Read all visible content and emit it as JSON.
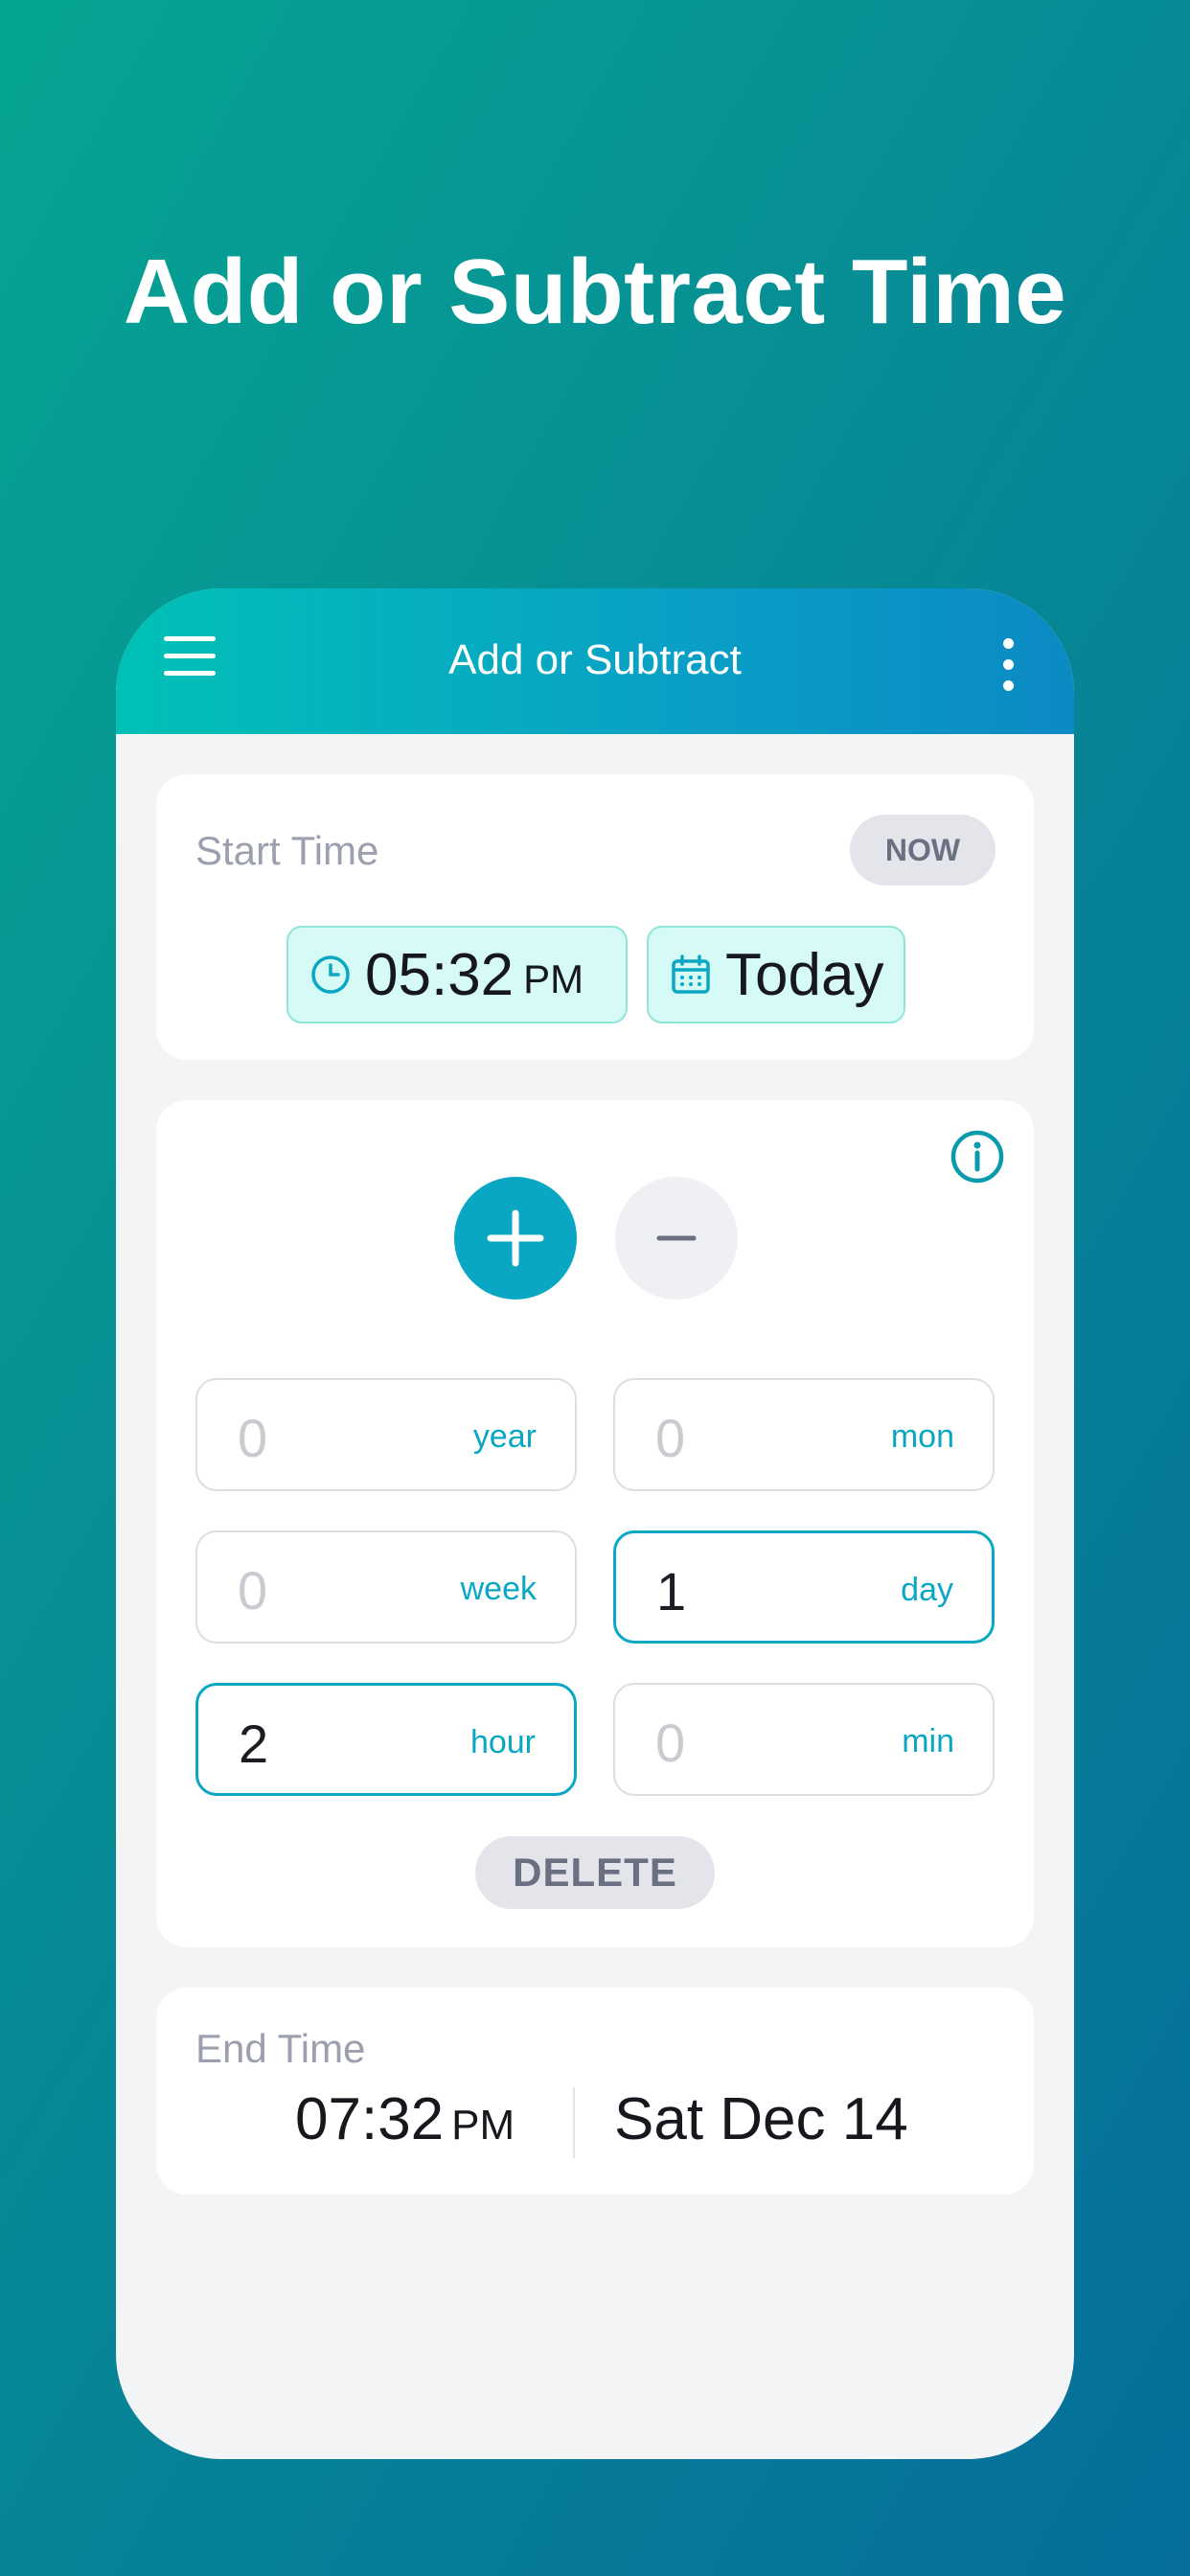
{
  "headline": "Add or Subtract Time",
  "appbar": {
    "title": "Add or Subtract",
    "menu_icon": "hamburger-menu-icon",
    "more_icon": "more-vertical-icon"
  },
  "start": {
    "label": "Start Time",
    "now_label": "NOW",
    "time": "05:32",
    "ampm": "PM",
    "date": "Today"
  },
  "ops": {
    "add_icon": "plus-icon",
    "subtract_icon": "minus-icon",
    "selected_operation": "add",
    "fields": [
      {
        "value": "0",
        "unit": "year",
        "active": false
      },
      {
        "value": "0",
        "unit": "mon",
        "active": false
      },
      {
        "value": "0",
        "unit": "week",
        "active": false
      },
      {
        "value": "1",
        "unit": "day",
        "active": true
      },
      {
        "value": "2",
        "unit": "hour",
        "active": true
      },
      {
        "value": "0",
        "unit": "min",
        "active": false
      }
    ],
    "delete_label": "DELETE"
  },
  "end": {
    "label": "End Time",
    "time": "07:32",
    "ampm": "PM",
    "date": "Sat Dec 14"
  },
  "colors": {
    "accent": "#0aa7c4",
    "chip_bg": "#d6faf6",
    "muted": "#9ca0ae"
  }
}
